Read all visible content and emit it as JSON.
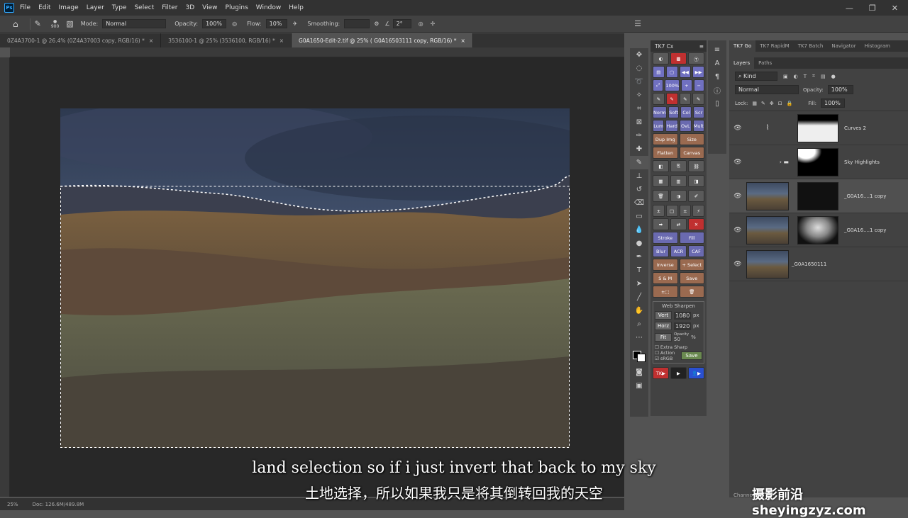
{
  "app": {
    "logo": "Ps",
    "menu": [
      "File",
      "Edit",
      "Image",
      "Layer",
      "Type",
      "Select",
      "Filter",
      "3D",
      "View",
      "Plugins",
      "Window",
      "Help"
    ]
  },
  "options": {
    "brush_size": "900",
    "mode_label": "Mode:",
    "mode_value": "Normal",
    "opacity_label": "Opacity:",
    "opacity_value": "100%",
    "flow_label": "Flow:",
    "flow_value": "10%",
    "smoothing_label": "Smoothing:",
    "angle_value": "2°"
  },
  "tabs": [
    "0Z4A3700-1 @ 26.4% (0Z4A37003 copy, RGB/16) *",
    "3536100-1 @ 25% (3536100, RGB/16) *",
    "G0A1650-Edit-2.tif @ 25% ( G0A16503111 copy, RGB/16) *"
  ],
  "status": {
    "zoom": "25%",
    "doc": "Doc: 126.6M/489.8M"
  },
  "subtitles": {
    "en": "land selection so if i just invert that back to my sky",
    "zh": "土地选择，所以如果我只是将其倒转回我的天空"
  },
  "watermark": "摄影前沿sheyingzyz.com",
  "tk7": {
    "title": "TK7 Cx",
    "rows": [
      [
        "Norm",
        "Soft",
        "Col",
        "Scr"
      ],
      [
        "Lum",
        "Hard",
        "OvL",
        "Mult"
      ]
    ],
    "buttons": {
      "dup": "Dup Img",
      "size": "Size",
      "flatten": "Flatten",
      "canvas": "Canvas",
      "stroke": "Stroke",
      "fill": "Fill",
      "blur": "Blur",
      "acr": "ACR",
      "caf": "CAF",
      "inverse": "Inverse",
      "plus_select": "+ Select",
      "sm": "S & M",
      "save": "Save",
      "zoom": "100%"
    },
    "websharpen": {
      "title": "Web Sharpen",
      "vert_label": "Vert",
      "vert_value": "1080",
      "horz_label": "Horz",
      "horz_value": "1920",
      "unit": "px",
      "fit": "Fit",
      "opacity_label": "Opacity",
      "opacity_value": "50",
      "pct": "%",
      "extra": "Extra Sharp",
      "action": "Action",
      "srgb": "sRGB",
      "save": "Save"
    },
    "tk_bottom": "TK"
  },
  "panel_tabs": [
    "TK7 Go",
    "TK7 RapidM",
    "TK7 Batch",
    "Navigator",
    "Histogram"
  ],
  "layers": {
    "tabs": [
      "Layers",
      "Paths"
    ],
    "kind": "Kind",
    "blend": "Normal",
    "opacity_label": "Opacity:",
    "opacity_value": "100%",
    "lock_label": "Lock:",
    "fill_label": "Fill:",
    "fill_value": "100%",
    "items": [
      {
        "name": "Curves 2"
      },
      {
        "name": "Sky Highlights"
      },
      {
        "name": "_G0A16....1 copy"
      },
      {
        "name": "_G0A16....1 copy"
      },
      {
        "name": "_G0A1650111"
      }
    ],
    "channels_label": "Channe"
  }
}
